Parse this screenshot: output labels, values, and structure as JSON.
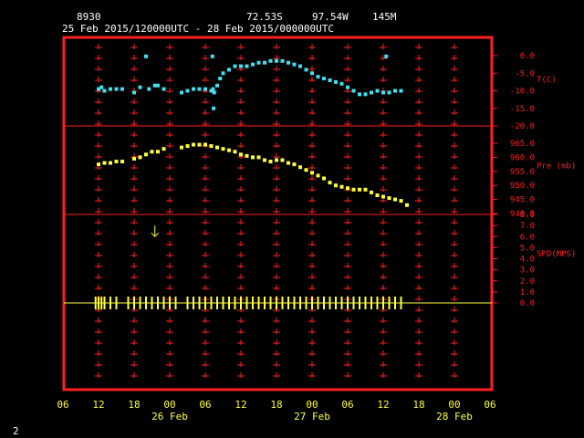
{
  "header": {
    "station_id": "8930",
    "lat": "72.53S",
    "lon": "97.54W",
    "elev": "145M",
    "period": "25 Feb 2015/120000UTC - 28 Feb 2015/000000UTC"
  },
  "footer": {
    "page_number": "2"
  },
  "colors": {
    "frame": "#ff2020",
    "temp": "#40e0f0",
    "press": "#ffff40",
    "wind": "#ffff40",
    "header": "#ffffff"
  },
  "chart_data": {
    "type": "scatter",
    "x_unit_hours_from": "25 Feb 06 UTC",
    "xlim": [
      0,
      72
    ],
    "x_ticks": [
      "06",
      "12",
      "18",
      "00",
      "06",
      "12",
      "18",
      "00",
      "06",
      "12",
      "18",
      "00",
      "06"
    ],
    "date_labels": [
      {
        "hour": 18,
        "label": "26 Feb"
      },
      {
        "hour": 42,
        "label": "27 Feb"
      },
      {
        "hour": 66,
        "label": "28 Feb"
      }
    ],
    "panels": [
      {
        "name": "temperature",
        "ylabel": "T(C)",
        "ylim": [
          -20,
          0
        ],
        "ticks": [
          "0.0",
          "-5.0",
          "-10.0",
          "-15.0",
          "-20.0"
        ],
        "points": [
          [
            6,
            -9.5
          ],
          [
            6.5,
            -9
          ],
          [
            7,
            -10
          ],
          [
            8,
            -9.5
          ],
          [
            9,
            -9.5
          ],
          [
            10,
            -9.5
          ],
          [
            12,
            -10.5
          ],
          [
            13,
            -9
          ],
          [
            14,
            -0.2
          ],
          [
            14.5,
            -9.5
          ],
          [
            15.5,
            -8.5
          ],
          [
            16,
            -8.5
          ],
          [
            17,
            -9.5
          ],
          [
            20,
            -10.5
          ],
          [
            21,
            -10
          ],
          [
            22,
            -9.5
          ],
          [
            23,
            -9.5
          ],
          [
            24,
            -9.5
          ],
          [
            25,
            -10
          ],
          [
            25.5,
            -10.5
          ],
          [
            25.3,
            -9.5
          ],
          [
            25.2,
            -0.2
          ],
          [
            25.4,
            -15
          ],
          [
            26,
            -8.5
          ],
          [
            26.5,
            -6.5
          ],
          [
            27,
            -5
          ],
          [
            28,
            -4
          ],
          [
            29,
            -3
          ],
          [
            30,
            -3
          ],
          [
            31,
            -3
          ],
          [
            32,
            -2.5
          ],
          [
            33,
            -2
          ],
          [
            34,
            -2
          ],
          [
            35,
            -1.5
          ],
          [
            36,
            -1.5
          ],
          [
            37,
            -1.5
          ],
          [
            38,
            -2
          ],
          [
            39,
            -2.5
          ],
          [
            40,
            -3
          ],
          [
            41,
            -4
          ],
          [
            42,
            -5
          ],
          [
            43,
            -6
          ],
          [
            44,
            -6.5
          ],
          [
            45,
            -7
          ],
          [
            46,
            -7.5
          ],
          [
            47,
            -8
          ],
          [
            48,
            -9
          ],
          [
            49,
            -10
          ],
          [
            50,
            -11
          ],
          [
            51,
            -11
          ],
          [
            52,
            -10.5
          ],
          [
            53,
            -10
          ],
          [
            54,
            -10.5
          ],
          [
            54.5,
            -0.2
          ],
          [
            55,
            -10.5
          ],
          [
            56,
            -10
          ],
          [
            57,
            -10
          ]
        ]
      },
      {
        "name": "pressure",
        "ylabel": "Pre (mb)",
        "ylim": [
          940,
          965
        ],
        "ticks": [
          "965.0",
          "960.0",
          "955.0",
          "950.0",
          "945.0",
          "940.0"
        ],
        "points": [
          [
            6,
            957.5
          ],
          [
            7,
            958
          ],
          [
            8,
            958
          ],
          [
            9,
            958.5
          ],
          [
            10,
            958.5
          ],
          [
            12,
            959.5
          ],
          [
            13,
            960
          ],
          [
            14,
            961
          ],
          [
            15,
            962
          ],
          [
            16,
            962
          ],
          [
            17,
            963
          ],
          [
            20,
            963.5
          ],
          [
            21,
            964
          ],
          [
            22,
            964.5
          ],
          [
            23,
            964.5
          ],
          [
            24,
            964.5
          ],
          [
            25,
            964
          ],
          [
            26,
            963.5
          ],
          [
            27,
            963
          ],
          [
            28,
            962.5
          ],
          [
            29,
            962
          ],
          [
            30,
            961
          ],
          [
            31,
            960.5
          ],
          [
            32,
            960
          ],
          [
            33,
            960
          ],
          [
            34,
            959
          ],
          [
            35,
            958.5
          ],
          [
            36,
            959
          ],
          [
            37,
            959
          ],
          [
            38,
            958
          ],
          [
            39,
            957.5
          ],
          [
            40,
            956.5
          ],
          [
            41,
            955.5
          ],
          [
            42,
            954.5
          ],
          [
            43,
            953.5
          ],
          [
            44,
            952.5
          ],
          [
            45,
            951
          ],
          [
            46,
            950
          ],
          [
            47,
            949.5
          ],
          [
            48,
            949
          ],
          [
            49,
            948.5
          ],
          [
            50,
            948.5
          ],
          [
            51,
            948.5
          ],
          [
            52,
            947.5
          ],
          [
            53,
            946.5
          ],
          [
            54,
            946
          ],
          [
            55,
            945.5
          ],
          [
            56,
            945
          ],
          [
            57,
            944.5
          ],
          [
            58,
            943
          ]
        ]
      },
      {
        "name": "wind",
        "ylabel": "SPD(MPS)",
        "ylim": [
          0,
          8
        ],
        "ticks": [
          "8.0",
          "7.0",
          "6.0",
          "5.0",
          "4.0",
          "3.0",
          "2.0",
          "1.0",
          "0.0"
        ],
        "arrow": {
          "hour": 15.5,
          "speed": 6.5,
          "direction": "down"
        },
        "ticks_at_zero": [
          5.5,
          6,
          6.5,
          7,
          8,
          9,
          11,
          12,
          13,
          14,
          15,
          16,
          17,
          18,
          19,
          21,
          22,
          23,
          24,
          25,
          26,
          27,
          28,
          29,
          30,
          31,
          32,
          33,
          34,
          35,
          36,
          37,
          38,
          39,
          40,
          41,
          42,
          43,
          44,
          45,
          46,
          47,
          48,
          49,
          50,
          51,
          52,
          53,
          54,
          55,
          56,
          57
        ]
      }
    ]
  }
}
